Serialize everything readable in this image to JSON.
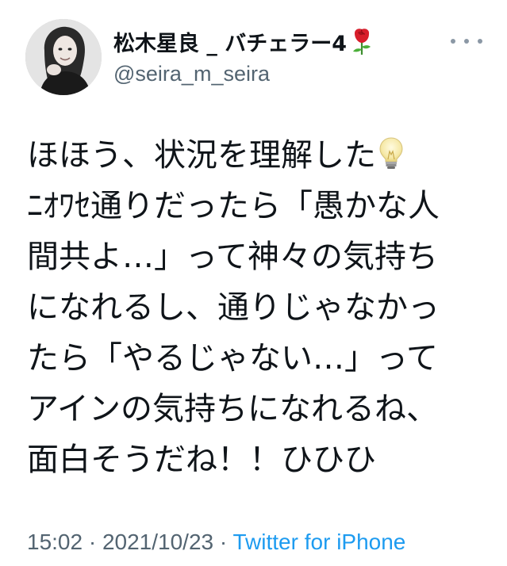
{
  "author": {
    "display_name": "松木星良 _ バチェラー4",
    "name_emoji": "rose-icon",
    "handle": "@seira_m_seira"
  },
  "tweet": {
    "lines": [
      "ほほう、状況を理解した",
      "ﾆｵﾜｾ通りだったら「愚かな人",
      "間共よ…」って神々の気持ち",
      "になれるし、通りじゃなかっ",
      "たら「やるじゃない…」って",
      "アインの気持ちになれるね、",
      "面白そうだね！！ひひひ"
    ],
    "inline_emoji": "lightbulb-icon"
  },
  "meta": {
    "time": "15:02",
    "sep1": " · ",
    "date": "2021/10/23",
    "sep2": " · ",
    "source": "Twitter for iPhone"
  },
  "colors": {
    "text": "#0f1419",
    "secondary": "#536471",
    "link": "#1d9bf0"
  }
}
